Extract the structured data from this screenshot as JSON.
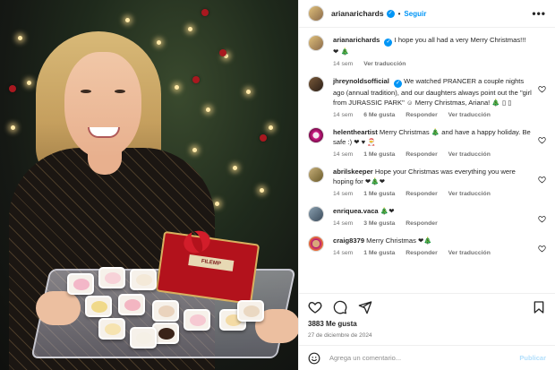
{
  "post": {
    "author": "arianarichards",
    "follow_label": "Seguir",
    "separator": "•",
    "more_label": "•••"
  },
  "caption": {
    "user": "arianarichards",
    "text": "I hope you all had a very Merry Christmas!!! ❤ 🎄",
    "time": "14 sem",
    "translate": "Ver traducción"
  },
  "comments": [
    {
      "user": "jhreynoldsofficial",
      "text": "We watched PRANCER a couple nights ago (annual tradition), and our daughters always point out the \"girl from JURASSIC PARK\" ☺ Merry Christmas, Ariana! 🎄 ▯ ▯",
      "time": "14 sem",
      "likes": "6 Me gusta",
      "reply": "Responder",
      "translate": "Ver traducción"
    },
    {
      "user": "helentheartist",
      "text": "Merry Christmas 🎄 and have a happy holiday. Be safe :) ❤ ♥ 🎅",
      "time": "14 sem",
      "likes": "1 Me gusta",
      "reply": "Responder",
      "translate": "Ver traducción"
    },
    {
      "user": "abrilskeeper",
      "text": "Hope your Christmas was everything you were hoping for ❤🎄❤",
      "time": "14 sem",
      "likes": "1 Me gusta",
      "reply": "Responder",
      "translate": "Ver traducción"
    },
    {
      "user": "enriquea.vaca",
      "text": "🎄❤",
      "time": "14 sem",
      "likes": "3 Me gusta",
      "reply": "Responder",
      "translate": ""
    },
    {
      "user": "craig8379",
      "text": "Merry Christmas ❤🎄",
      "time": "14 sem",
      "likes": "1 Me gusta",
      "reply": "Responder",
      "translate": "Ver traducción"
    }
  ],
  "stats": {
    "likes": "3883 Me gusta",
    "date": "27 de diciembre de 2024"
  },
  "composer": {
    "placeholder": "Agrega un comentario...",
    "publish": "Publicar"
  },
  "photo": {
    "gift_label": "FILEMP"
  },
  "colors": {
    "accent": "#0095f6",
    "muted": "#737373",
    "text": "#262626"
  }
}
